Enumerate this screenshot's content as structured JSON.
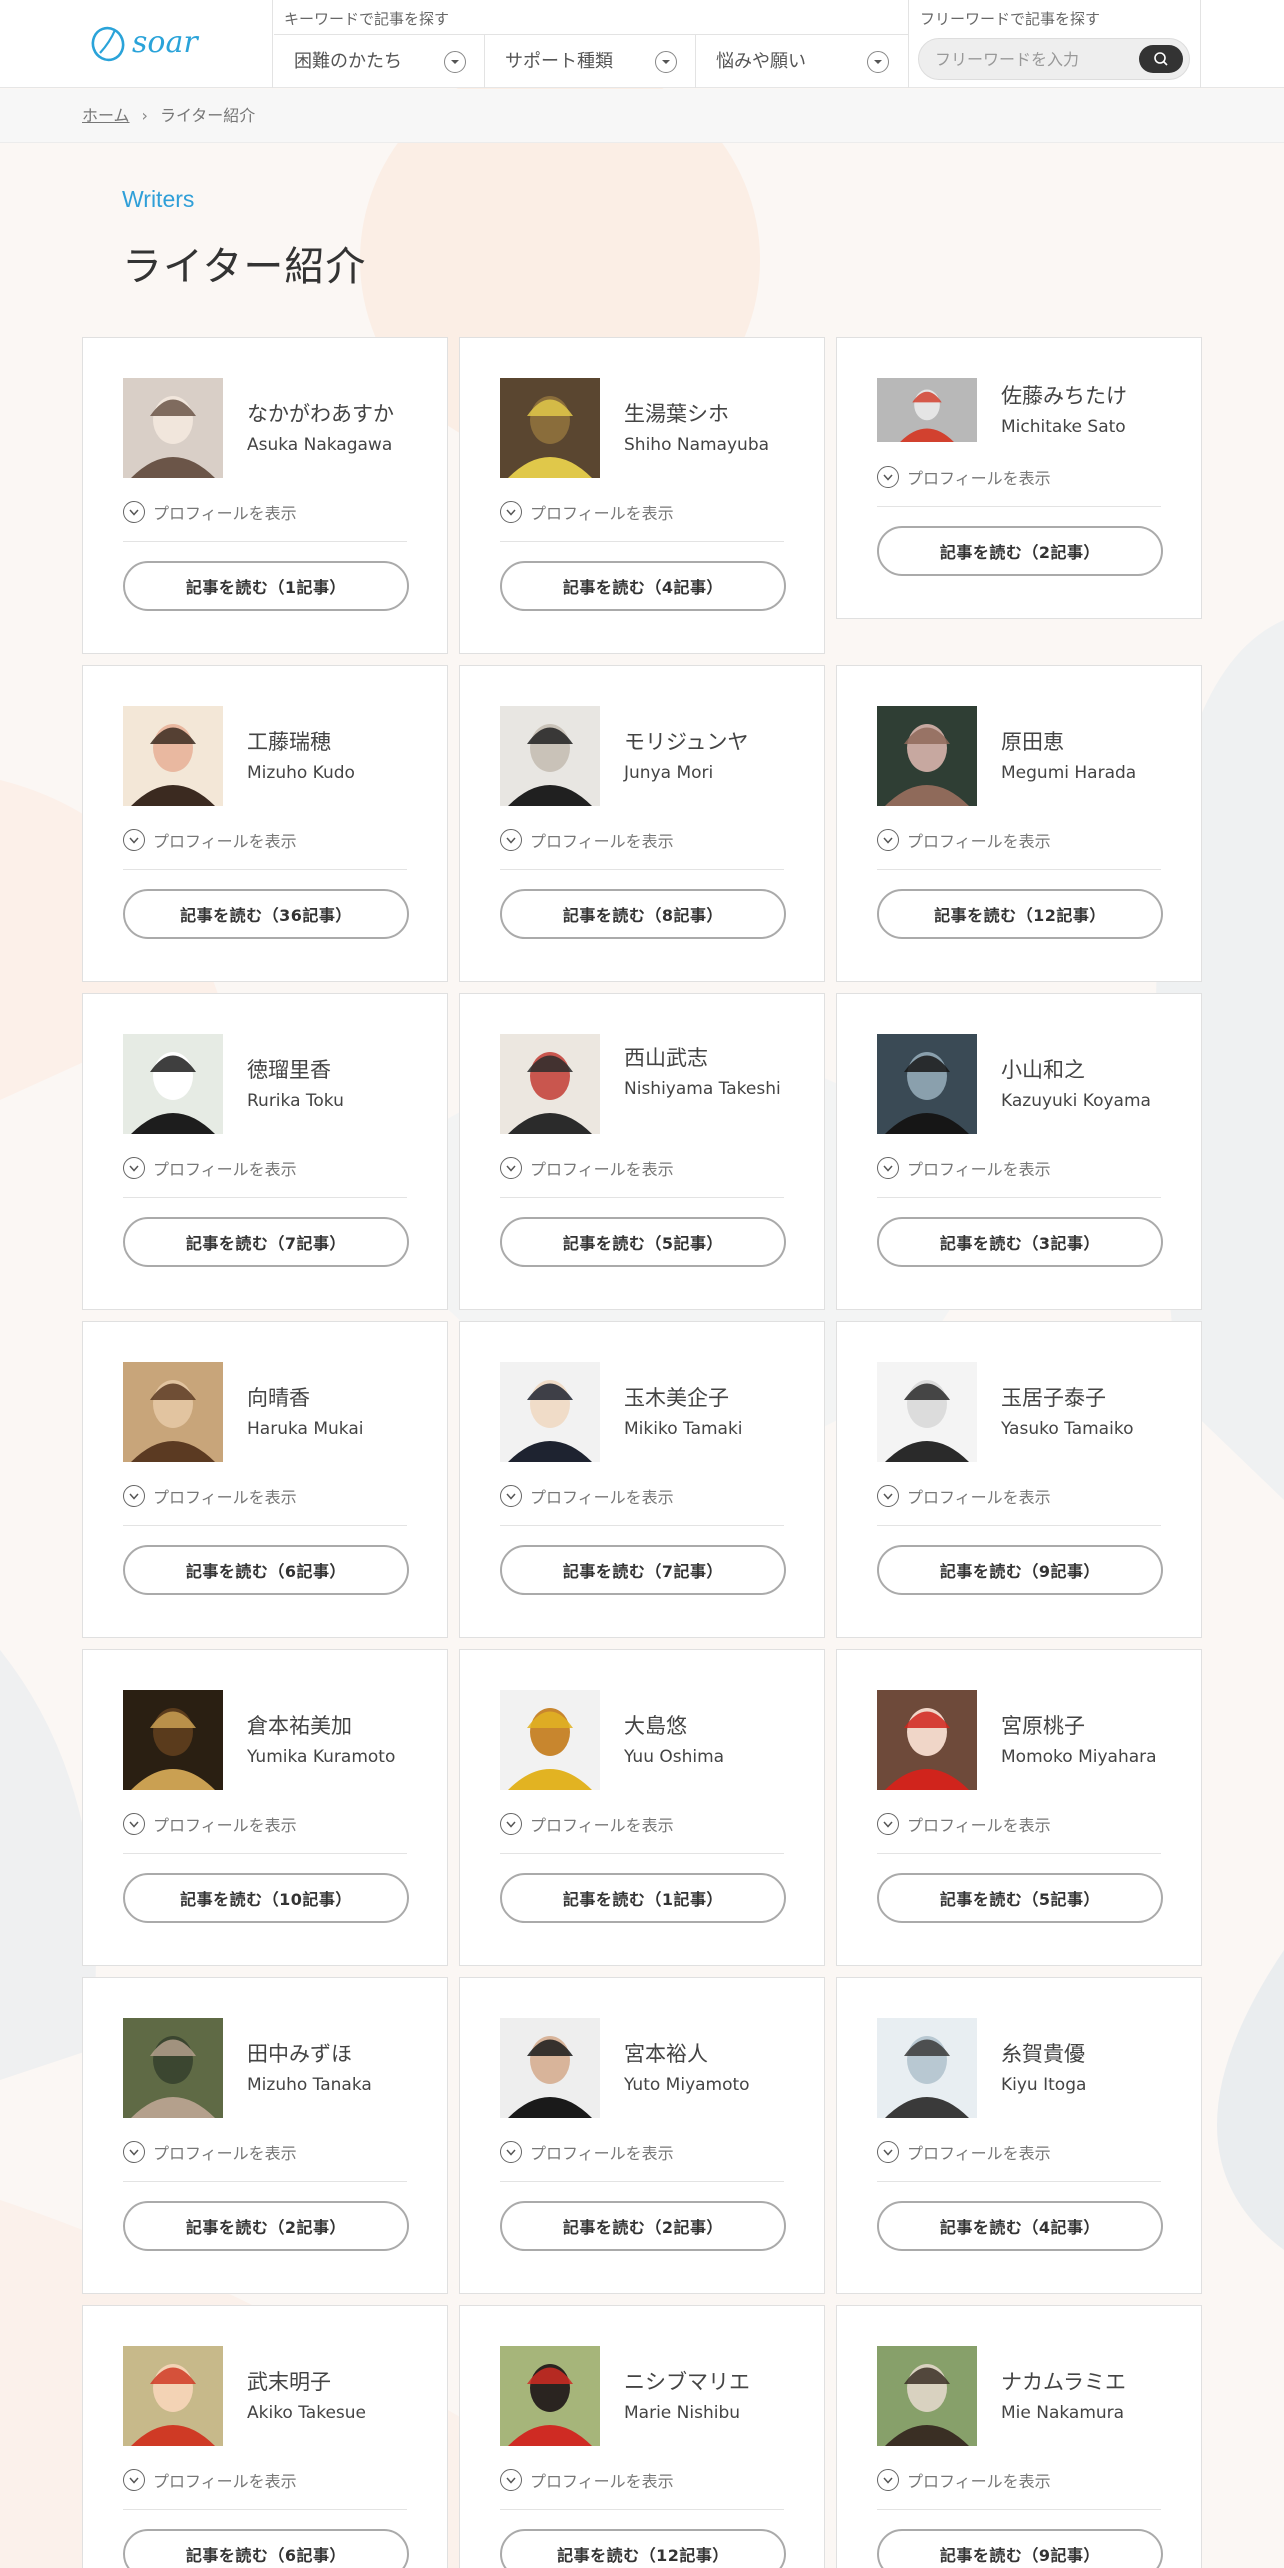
{
  "header": {
    "logo_text": "soar",
    "keyword_caption": "キーワードで記事を探す",
    "selects": [
      {
        "label": "困難のかたち"
      },
      {
        "label": "サポート種類"
      },
      {
        "label": "悩みや願い"
      }
    ],
    "freeword_caption": "フリーワードで記事を探す",
    "search_placeholder": "フリーワードを入力"
  },
  "breadcrumb": {
    "home": "ホーム",
    "current": "ライター紹介"
  },
  "section_label": "Writers",
  "page_title": "ライター紹介",
  "profile_label": "プロフィールを表示",
  "colors": {
    "accent": "#2f9fd8",
    "logo": "#2aa3d9"
  },
  "writers": [
    {
      "jp": "なかがわあすか",
      "en": "Asuka Nakagawa",
      "read": "記事を読む（1記事）",
      "photo": "photo-1"
    },
    {
      "jp": "生湯葉シホ",
      "en": "Shiho Namayuba",
      "read": "記事を読む（4記事）",
      "photo": "photo-2"
    },
    {
      "jp": "佐藤みちたけ",
      "en": "Michitake Sato",
      "read": "記事を読む（2記事）",
      "photo": "photo-3"
    },
    {
      "jp": "工藤瑞穂",
      "en": "Mizuho Kudo",
      "read": "記事を読む（36記事）",
      "photo": "photo-4"
    },
    {
      "jp": "モリジュンヤ",
      "en": "Junya Mori",
      "read": "記事を読む（8記事）",
      "photo": "photo-5"
    },
    {
      "jp": "原田恵",
      "en": "Megumi Harada",
      "read": "記事を読む（12記事）",
      "photo": "photo-6"
    },
    {
      "jp": "徳瑠里香",
      "en": "Rurika Toku",
      "read": "記事を読む（7記事）",
      "photo": "photo-7"
    },
    {
      "jp": "西山武志",
      "en": "Nishiyama Takeshi",
      "read": "記事を読む（5記事）",
      "photo": "photo-8"
    },
    {
      "jp": "小山和之",
      "en": "Kazuyuki Koyama",
      "read": "記事を読む（3記事）",
      "photo": "photo-9"
    },
    {
      "jp": "向晴香",
      "en": "Haruka Mukai",
      "read": "記事を読む（6記事）",
      "photo": "photo-10"
    },
    {
      "jp": "玉木美企子",
      "en": "Mikiko Tamaki",
      "read": "記事を読む（7記事）",
      "photo": "photo-11"
    },
    {
      "jp": "玉居子泰子",
      "en": "Yasuko Tamaiko",
      "read": "記事を読む（9記事）",
      "photo": "photo-12"
    },
    {
      "jp": "倉本祐美加",
      "en": "Yumika Kuramoto",
      "read": "記事を読む（10記事）",
      "photo": "photo-13"
    },
    {
      "jp": "大島悠",
      "en": "Yuu Oshima",
      "read": "記事を読む（1記事）",
      "photo": "photo-14"
    },
    {
      "jp": "宮原桃子",
      "en": "Momoko Miyahara",
      "read": "記事を読む（5記事）",
      "photo": "photo-15"
    },
    {
      "jp": "田中みずほ",
      "en": "Mizuho Tanaka",
      "read": "記事を読む（2記事）",
      "photo": "photo-16"
    },
    {
      "jp": "宮本裕人",
      "en": "Yuto Miyamoto",
      "read": "記事を読む（2記事）",
      "photo": "photo-17"
    },
    {
      "jp": "糸賀貴優",
      "en": "Kiyu Itoga",
      "read": "記事を読む（4記事）",
      "photo": "photo-18"
    },
    {
      "jp": "武末明子",
      "en": "Akiko Takesue",
      "read": "記事を読む（6記事）",
      "photo": "photo-19"
    },
    {
      "jp": "ニシブマリエ",
      "en": "Marie Nishibu",
      "read": "記事を読む（12記事）",
      "photo": "photo-20"
    },
    {
      "jp": "ナカムラミエ",
      "en": "Mie Nakamura",
      "read": "記事を読む（9記事）",
      "photo": "photo-21"
    }
  ]
}
